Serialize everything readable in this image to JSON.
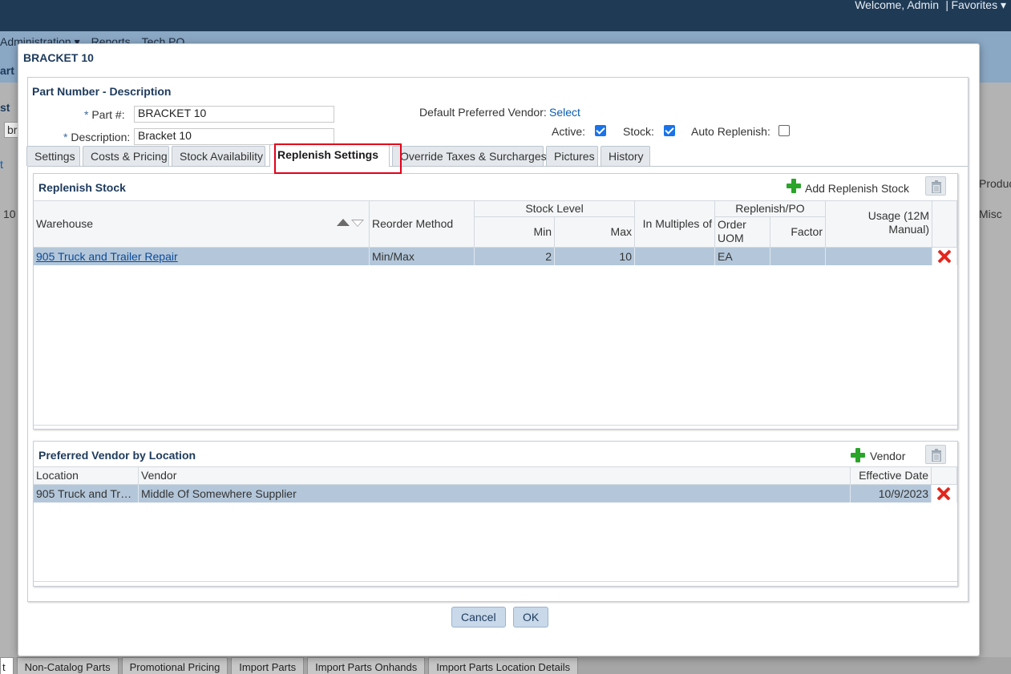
{
  "topbar": {
    "welcome": "Welcome, Admin",
    "separator": "|",
    "favorites": "Favorites"
  },
  "background": {
    "menu": [
      "Administration ▾",
      "Reports",
      "Tech PO"
    ],
    "frags": [
      "art I",
      "st",
      "br",
      "t",
      "10",
      "Produc",
      "Misc"
    ],
    "bottom_tabs": [
      "t",
      "Non-Catalog Parts",
      "Promotional Pricing",
      "Import Parts",
      "Import Parts Onhands",
      "Import Parts Location Details"
    ]
  },
  "dialog": {
    "title": "BRACKET 10",
    "part_header": "Part Number - Description",
    "part_number_label": "Part #:",
    "part_number_value": "BRACKET 10",
    "description_label": "Description:",
    "description_value": "Bracket 10",
    "required_mark": "*",
    "vendor_label": "Default Preferred Vendor:",
    "vendor_link": "Select",
    "active_label": "Active:",
    "active_checked": true,
    "stock_label": "Stock:",
    "stock_checked": true,
    "auto_replenish_label": "Auto Replenish:",
    "auto_replenish_checked": false,
    "tabs": [
      "Settings",
      "Costs & Pricing",
      "Stock Availability",
      "Replenish Settings",
      "Override Taxes & Surcharges",
      "Pictures",
      "History"
    ],
    "active_tab": "Replenish Settings",
    "highlight_color": "#e3001b",
    "replenish": {
      "title": "Replenish Stock",
      "add_label": "Add Replenish Stock",
      "headers": {
        "warehouse": "Warehouse",
        "reorder_method": "Reorder Method",
        "stock_level": "Stock Level",
        "min": "Min",
        "max": "Max",
        "in_multiples_of": "In Multiples of",
        "replenish_po": "Replenish/PO",
        "order_uom": "Order UOM",
        "factor": "Factor",
        "usage": "Usage (12M Manual)"
      },
      "rows": [
        {
          "warehouse": "905 Truck and Trailer Repair",
          "reorder_method": "Min/Max",
          "min": "2",
          "max": "10",
          "in_multiples_of": "",
          "order_uom": "EA",
          "factor": "",
          "usage": ""
        }
      ]
    },
    "vendor_by_location": {
      "title": "Preferred Vendor by Location",
      "add_label": "Vendor",
      "headers": {
        "location": "Location",
        "vendor": "Vendor",
        "effective_date": "Effective Date"
      },
      "rows": [
        {
          "location": "905 Truck and Trai...",
          "vendor": "Middle Of Somewhere Supplier",
          "effective_date": "10/9/2023"
        }
      ]
    },
    "cancel_label": "Cancel",
    "ok_label": "OK"
  }
}
